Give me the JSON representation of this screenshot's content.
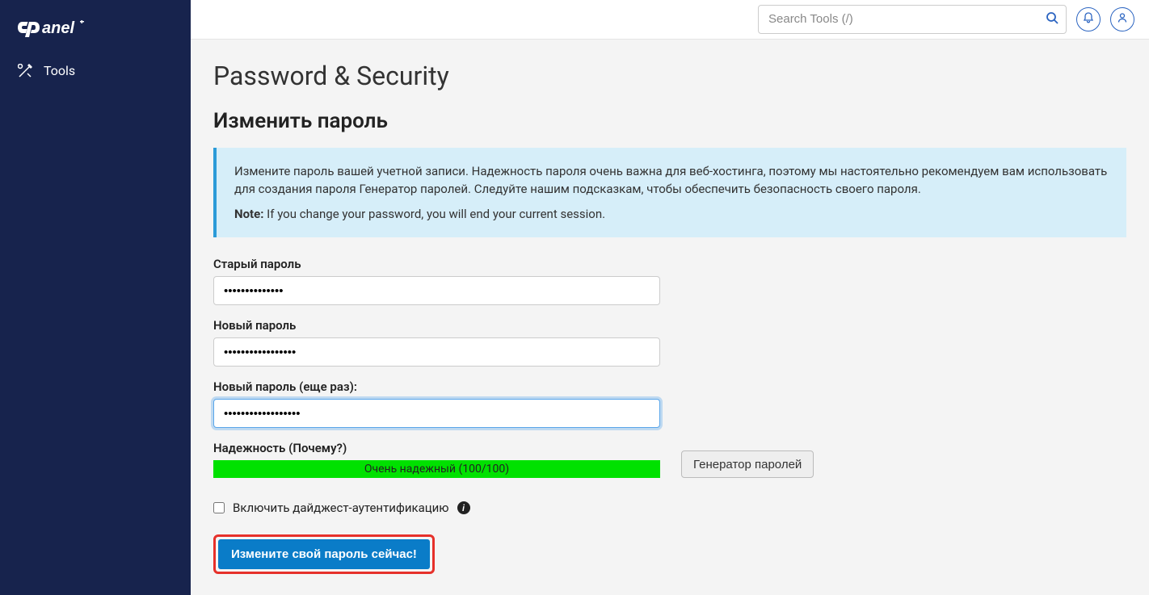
{
  "sidebar": {
    "logo_alt": "cPanel",
    "nav": {
      "tools_label": "Tools"
    }
  },
  "topbar": {
    "search_placeholder": "Search Tools (/)"
  },
  "page": {
    "title": "Password & Security",
    "section_title": "Изменить пароль",
    "info": {
      "text": "Измените пароль вашей учетной записи. Надежность пароля очень важна для веб-хостинга, поэтому мы настоятельно рекомендуем вам использовать для создания пароля Генератор паролей. Следуйте нашим подсказкам, чтобы обеспечить безопасность своего пароля.",
      "note_label": "Note:",
      "note_text": " If you change your password, you will end your current session."
    },
    "form": {
      "old_password_label": "Старый пароль",
      "old_password_value": "••••••••••••••",
      "new_password_label": "Новый пароль",
      "new_password_value": "•••••••••••••••••",
      "confirm_password_label": "Новый пароль (еще раз):",
      "confirm_password_value": "••••••••••••••••••",
      "strength_label": "Надежность (Почему?)",
      "strength_text": "Очень надежный (100/100)",
      "generator_label": "Генератор паролей",
      "digest_label": "Включить дайджест-аутентификацию",
      "submit_label": "Измените свой пароль сейчас!"
    }
  }
}
